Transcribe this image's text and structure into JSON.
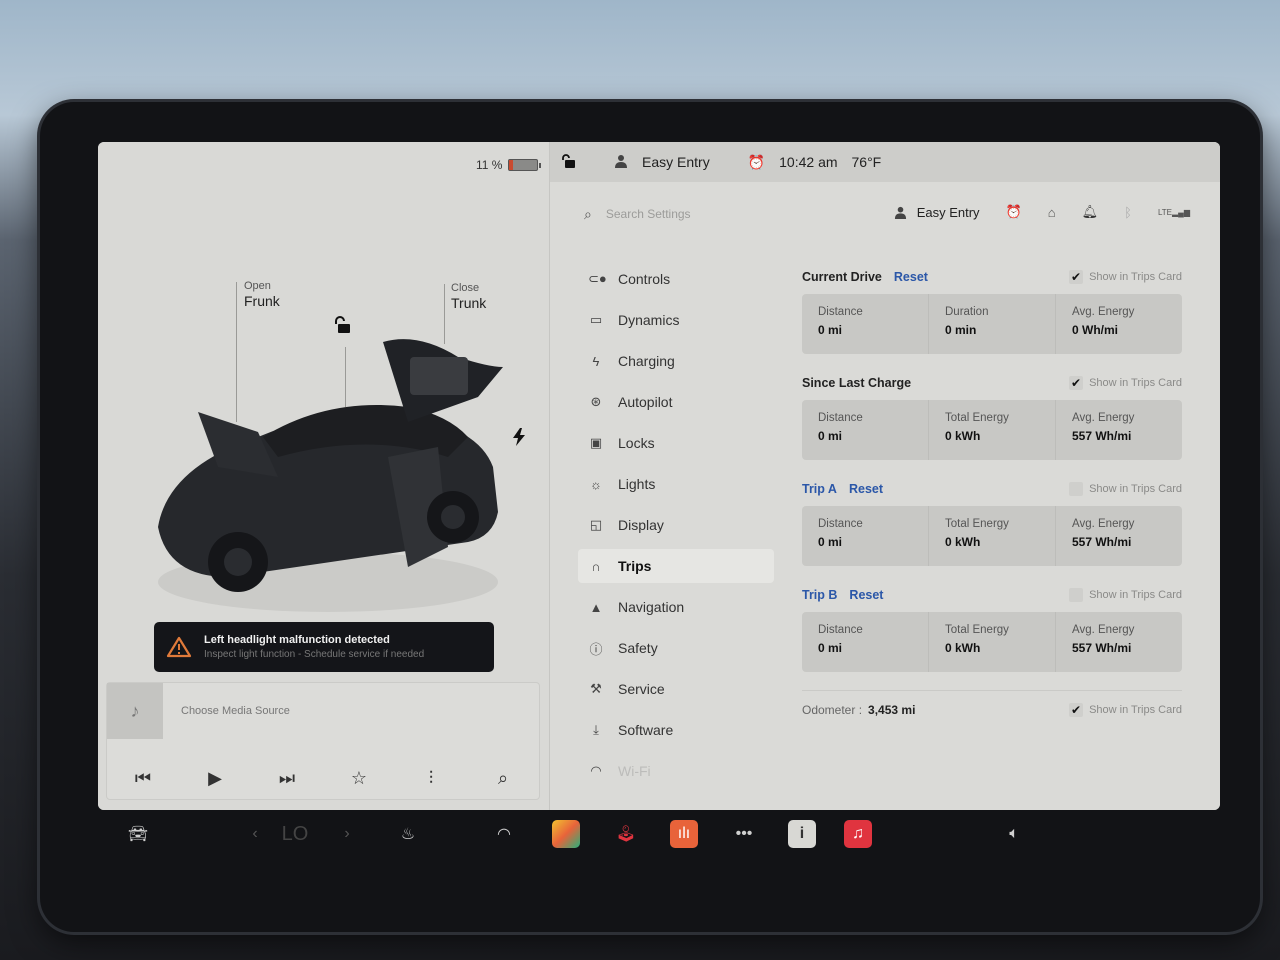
{
  "status": {
    "battery_percent_label": "11 %",
    "battery_level": 0.11,
    "profile_name": "Easy Entry",
    "time": "10:42 am",
    "temperature": "76°F"
  },
  "vehicle": {
    "frunk": {
      "action": "Open",
      "label": "Frunk"
    },
    "trunk": {
      "action": "Close",
      "label": "Trunk"
    }
  },
  "alert": {
    "title": "Left headlight malfunction detected",
    "subtitle": "Inspect light function - Schedule service if needed",
    "accent_color": "#e07a3a"
  },
  "media": {
    "source_label": "Choose Media Source"
  },
  "search": {
    "placeholder": "Search Settings"
  },
  "header_right": {
    "profile_name": "Easy Entry",
    "signal_label": "LTE"
  },
  "menu": [
    {
      "label": "Controls",
      "icon": "toggle-icon"
    },
    {
      "label": "Dynamics",
      "icon": "car-icon"
    },
    {
      "label": "Charging",
      "icon": "bolt-icon"
    },
    {
      "label": "Autopilot",
      "icon": "steering-wheel-icon"
    },
    {
      "label": "Locks",
      "icon": "lock-icon"
    },
    {
      "label": "Lights",
      "icon": "light-icon"
    },
    {
      "label": "Display",
      "icon": "display-icon"
    },
    {
      "label": "Trips",
      "icon": "trips-icon",
      "active": true
    },
    {
      "label": "Navigation",
      "icon": "navigation-icon"
    },
    {
      "label": "Safety",
      "icon": "safety-icon"
    },
    {
      "label": "Service",
      "icon": "wrench-icon"
    },
    {
      "label": "Software",
      "icon": "download-icon"
    },
    {
      "label": "Wi-Fi",
      "icon": "wifi-icon"
    }
  ],
  "trips": {
    "show_label": "Show in Trips Card",
    "reset_label": "Reset",
    "current_drive": {
      "title": "Current Drive",
      "show_checked": true,
      "stats": [
        {
          "label": "Distance",
          "value": "0 mi"
        },
        {
          "label": "Duration",
          "value": "0 min"
        },
        {
          "label": "Avg. Energy",
          "value": "0 Wh/mi"
        }
      ]
    },
    "since_last_charge": {
      "title": "Since Last Charge",
      "show_checked": true,
      "stats": [
        {
          "label": "Distance",
          "value": "0 mi"
        },
        {
          "label": "Total Energy",
          "value": "0 kWh"
        },
        {
          "label": "Avg. Energy",
          "value": "557 Wh/mi"
        }
      ]
    },
    "trip_a": {
      "title": "Trip A",
      "show_checked": false,
      "stats": [
        {
          "label": "Distance",
          "value": "0 mi"
        },
        {
          "label": "Total Energy",
          "value": "0 kWh"
        },
        {
          "label": "Avg. Energy",
          "value": "557 Wh/mi"
        }
      ]
    },
    "trip_b": {
      "title": "Trip B",
      "show_checked": false,
      "stats": [
        {
          "label": "Distance",
          "value": "0 mi"
        },
        {
          "label": "Total Energy",
          "value": "0 kWh"
        },
        {
          "label": "Avg. Energy",
          "value": "557 Wh/mi"
        }
      ]
    },
    "odometer": {
      "label": "Odometer :",
      "value": "3,453 mi",
      "show_checked": true
    }
  },
  "dock": {
    "temperature_label": "LO",
    "colors": {
      "orange_app": "#e8633a",
      "red_app": "#e0343f"
    }
  }
}
